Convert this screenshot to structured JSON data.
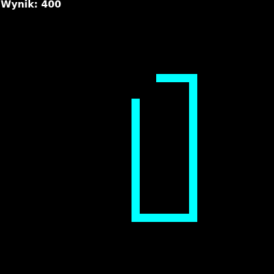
{
  "game": {
    "score_text": "Wynik: 400",
    "snake_color": "#00ffff",
    "background_color": "#000000",
    "snake": {
      "segment_count": 6,
      "description_shape": "open rectangle path"
    }
  }
}
